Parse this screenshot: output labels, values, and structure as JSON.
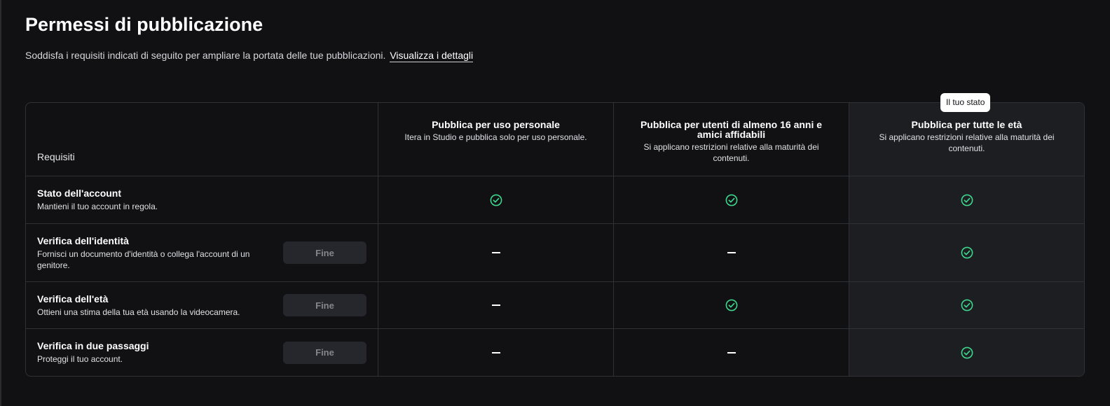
{
  "header": {
    "title": "Permessi di pubblicazione",
    "subtitle": "Soddisfa i requisiti indicati di seguito per ampliare la portata delle tue pubblicazioni.",
    "details_link": "Visualizza i dettagli"
  },
  "badge": {
    "label": "Il tuo stato"
  },
  "table": {
    "requirements_header": "Requisiti",
    "columns": [
      {
        "title": "Pubblica per uso personale",
        "description": "Itera in Studio e pubblica solo per uso personale."
      },
      {
        "title": "Pubblica per utenti di almeno 16 anni e amici affidabili",
        "description": "Si applicano restrizioni relative alla maturità dei contenuti."
      },
      {
        "title": "Pubblica per tutte le età",
        "description": "Si applicano restrizioni relative alla maturità dei contenuti."
      }
    ],
    "rows": [
      {
        "title": "Stato dell'account",
        "description": "Mantieni il tuo account in regola.",
        "button": null,
        "status": [
          "check",
          "check",
          "check"
        ]
      },
      {
        "title": "Verifica dell'identità",
        "description": "Fornisci un documento d'identità o collega l'account di un genitore.",
        "button": "Fine",
        "status": [
          "dash",
          "dash",
          "check"
        ]
      },
      {
        "title": "Verifica dell'età",
        "description": "Ottieni una stima della tua età usando la videocamera.",
        "button": "Fine",
        "status": [
          "dash",
          "check",
          "check"
        ]
      },
      {
        "title": "Verifica in due passaggi",
        "description": "Proteggi il tuo account.",
        "button": "Fine",
        "status": [
          "dash",
          "dash",
          "check"
        ]
      }
    ]
  },
  "icons": {
    "check": "check-circle-icon",
    "dash": "dash-icon"
  },
  "colors": {
    "background": "#111114",
    "highlight_column": "#1d1e22",
    "border": "#303137",
    "check_green": "#3dd68c",
    "button_bg": "#26272c",
    "button_text": "#85868c"
  }
}
